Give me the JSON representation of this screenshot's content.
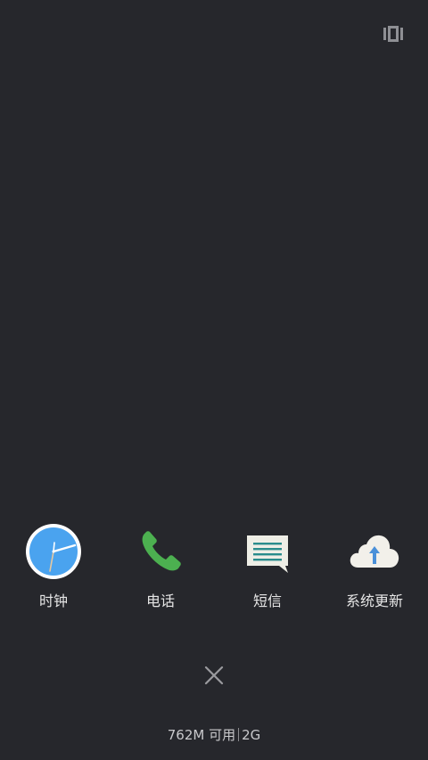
{
  "top_bar": {
    "icon": "multiwindow-icon"
  },
  "apps": [
    {
      "label": "时钟",
      "icon": "clock-icon"
    },
    {
      "label": "电话",
      "icon": "phone-icon"
    },
    {
      "label": "短信",
      "icon": "message-icon"
    },
    {
      "label": "系统更新",
      "icon": "cloud-upload-icon"
    }
  ],
  "close": {
    "icon": "close-icon"
  },
  "memory": {
    "available": "762M 可用",
    "total": "2G"
  },
  "colors": {
    "background": "#26272c",
    "clock_face": "#4aa3ef",
    "phone_green": "#4cb050",
    "message_bg": "#eeeee6",
    "message_lines": "#2a8c8c",
    "cloud": "#f2f0ea",
    "arrow_blue": "#4a90d9"
  }
}
